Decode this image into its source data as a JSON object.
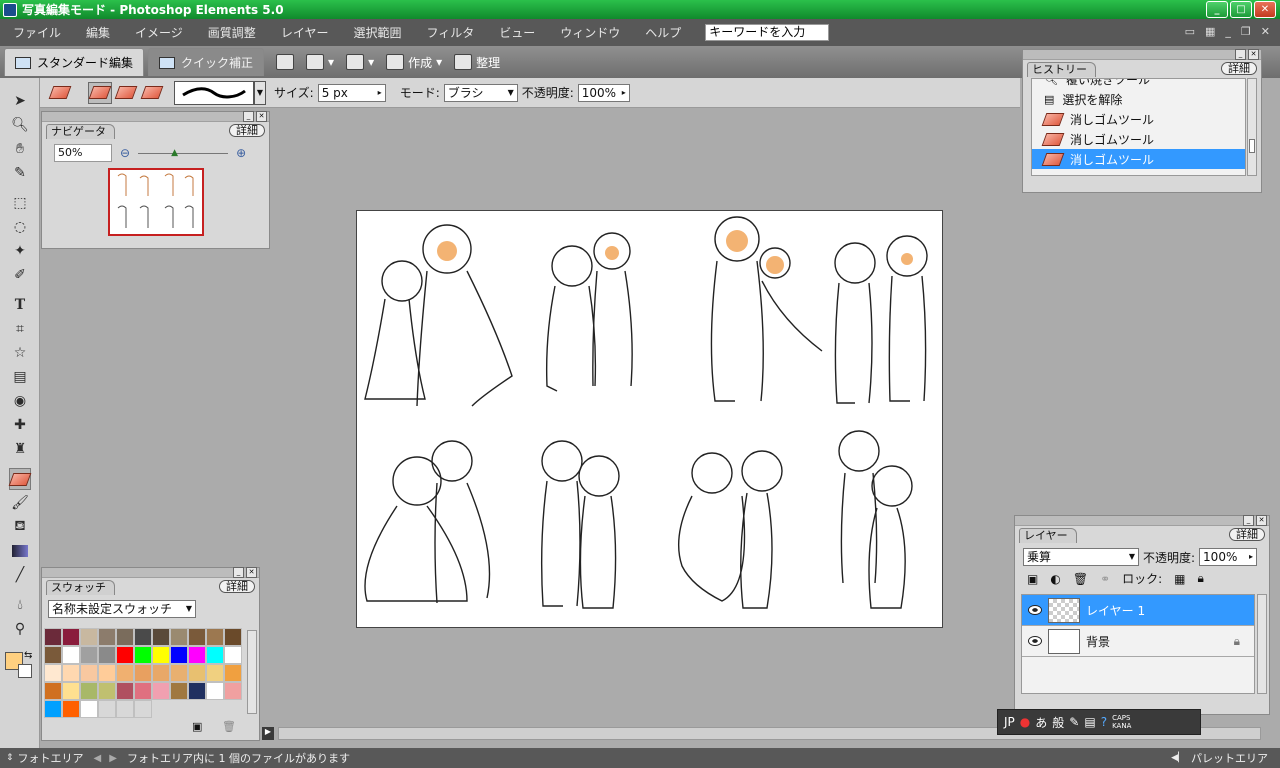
{
  "window": {
    "title": "写真編集モード - Photoshop Elements 5.0"
  },
  "menu": {
    "items": [
      "ファイル",
      "編集",
      "イメージ",
      "画質調整",
      "レイヤー",
      "選択範囲",
      "フィルタ",
      "ビュー",
      "ウィンドウ",
      "ヘルプ"
    ],
    "keyword_placeholder": "キーワードを入力"
  },
  "modebar": {
    "standard": "スタンダード編集",
    "quick": "クイック補正",
    "create": "作成",
    "organize": "整理"
  },
  "options": {
    "size_label": "サイズ:",
    "size_value": "5 px",
    "mode_label": "モード:",
    "mode_value": "ブラシ",
    "opacity_label": "不透明度:",
    "opacity_value": "100%"
  },
  "navigator": {
    "tab": "ナビゲータ",
    "detail": "詳細",
    "zoom": "50%"
  },
  "swatches": {
    "tab": "スウォッチ",
    "detail": "詳細",
    "set": "名称未設定スウォッチ",
    "colors": [
      "#6b2a3a",
      "#8a1c3c",
      "#c8b8a0",
      "#8c7c6c",
      "#7a6c5c",
      "#4a4a4a",
      "#5a4a3a",
      "#9a8a70",
      "#7a5a3a",
      "#9c7850",
      "#6a4a2a",
      "#7a5a3a",
      "#ffffff",
      "#a0a0a0",
      "#8a8a8a",
      "#ff0000",
      "#00ff00",
      "#ffff00",
      "#0000ff",
      "#ff00ff",
      "#00ffff",
      "#ffffff",
      "#ffe8d0",
      "#ffd8b0",
      "#f8c8a0",
      "#ffcc99",
      "#f0b070",
      "#e8a060",
      "#e8a868",
      "#e8b070",
      "#e8c070",
      "#f0d080",
      "#f0a040",
      "#d07020",
      "#ffe090",
      "#a8b868",
      "#c0c070",
      "#b05060",
      "#e07080",
      "#f0a0b0",
      "#a07840",
      "#203060",
      "#ffffff",
      "#f0a0a0",
      "#00a0ff",
      "#ff6000",
      "#ffffff",
      "#d8d8d8",
      "#d8d8d8",
      "#d8d8d8"
    ]
  },
  "history": {
    "tab": "ヒストリー",
    "detail": "詳細",
    "items": [
      {
        "label": "覆い焼きツール",
        "icon": "dodge-icon"
      },
      {
        "label": "選択を解除",
        "icon": "deselect-icon"
      },
      {
        "label": "消しゴムツール",
        "icon": "eraser-icon"
      },
      {
        "label": "消しゴムツール",
        "icon": "eraser-icon"
      },
      {
        "label": "消しゴムツール",
        "icon": "eraser-icon"
      }
    ]
  },
  "layers": {
    "tab": "レイヤー",
    "detail": "詳細",
    "blend": "乗算",
    "opacity_label": "不透明度:",
    "opacity_value": "100%",
    "lock_label": "ロック:",
    "items": [
      {
        "name": "レイヤー 1",
        "selected": true
      },
      {
        "name": "背景",
        "selected": false
      }
    ]
  },
  "status": {
    "photo_area": "フォトエリア",
    "message": "フォトエリア内に 1 個のファイルがあります",
    "palette_area": "パレットエリア"
  },
  "ime": {
    "lang": "JP",
    "hira": "あ",
    "mode": "般",
    "caps": "CAPS",
    "kana": "KANA"
  },
  "colors": {
    "accent": "#3399ff",
    "title_green": "#1ea63d",
    "foreground": "#ffd080",
    "background": "#ffffff"
  }
}
